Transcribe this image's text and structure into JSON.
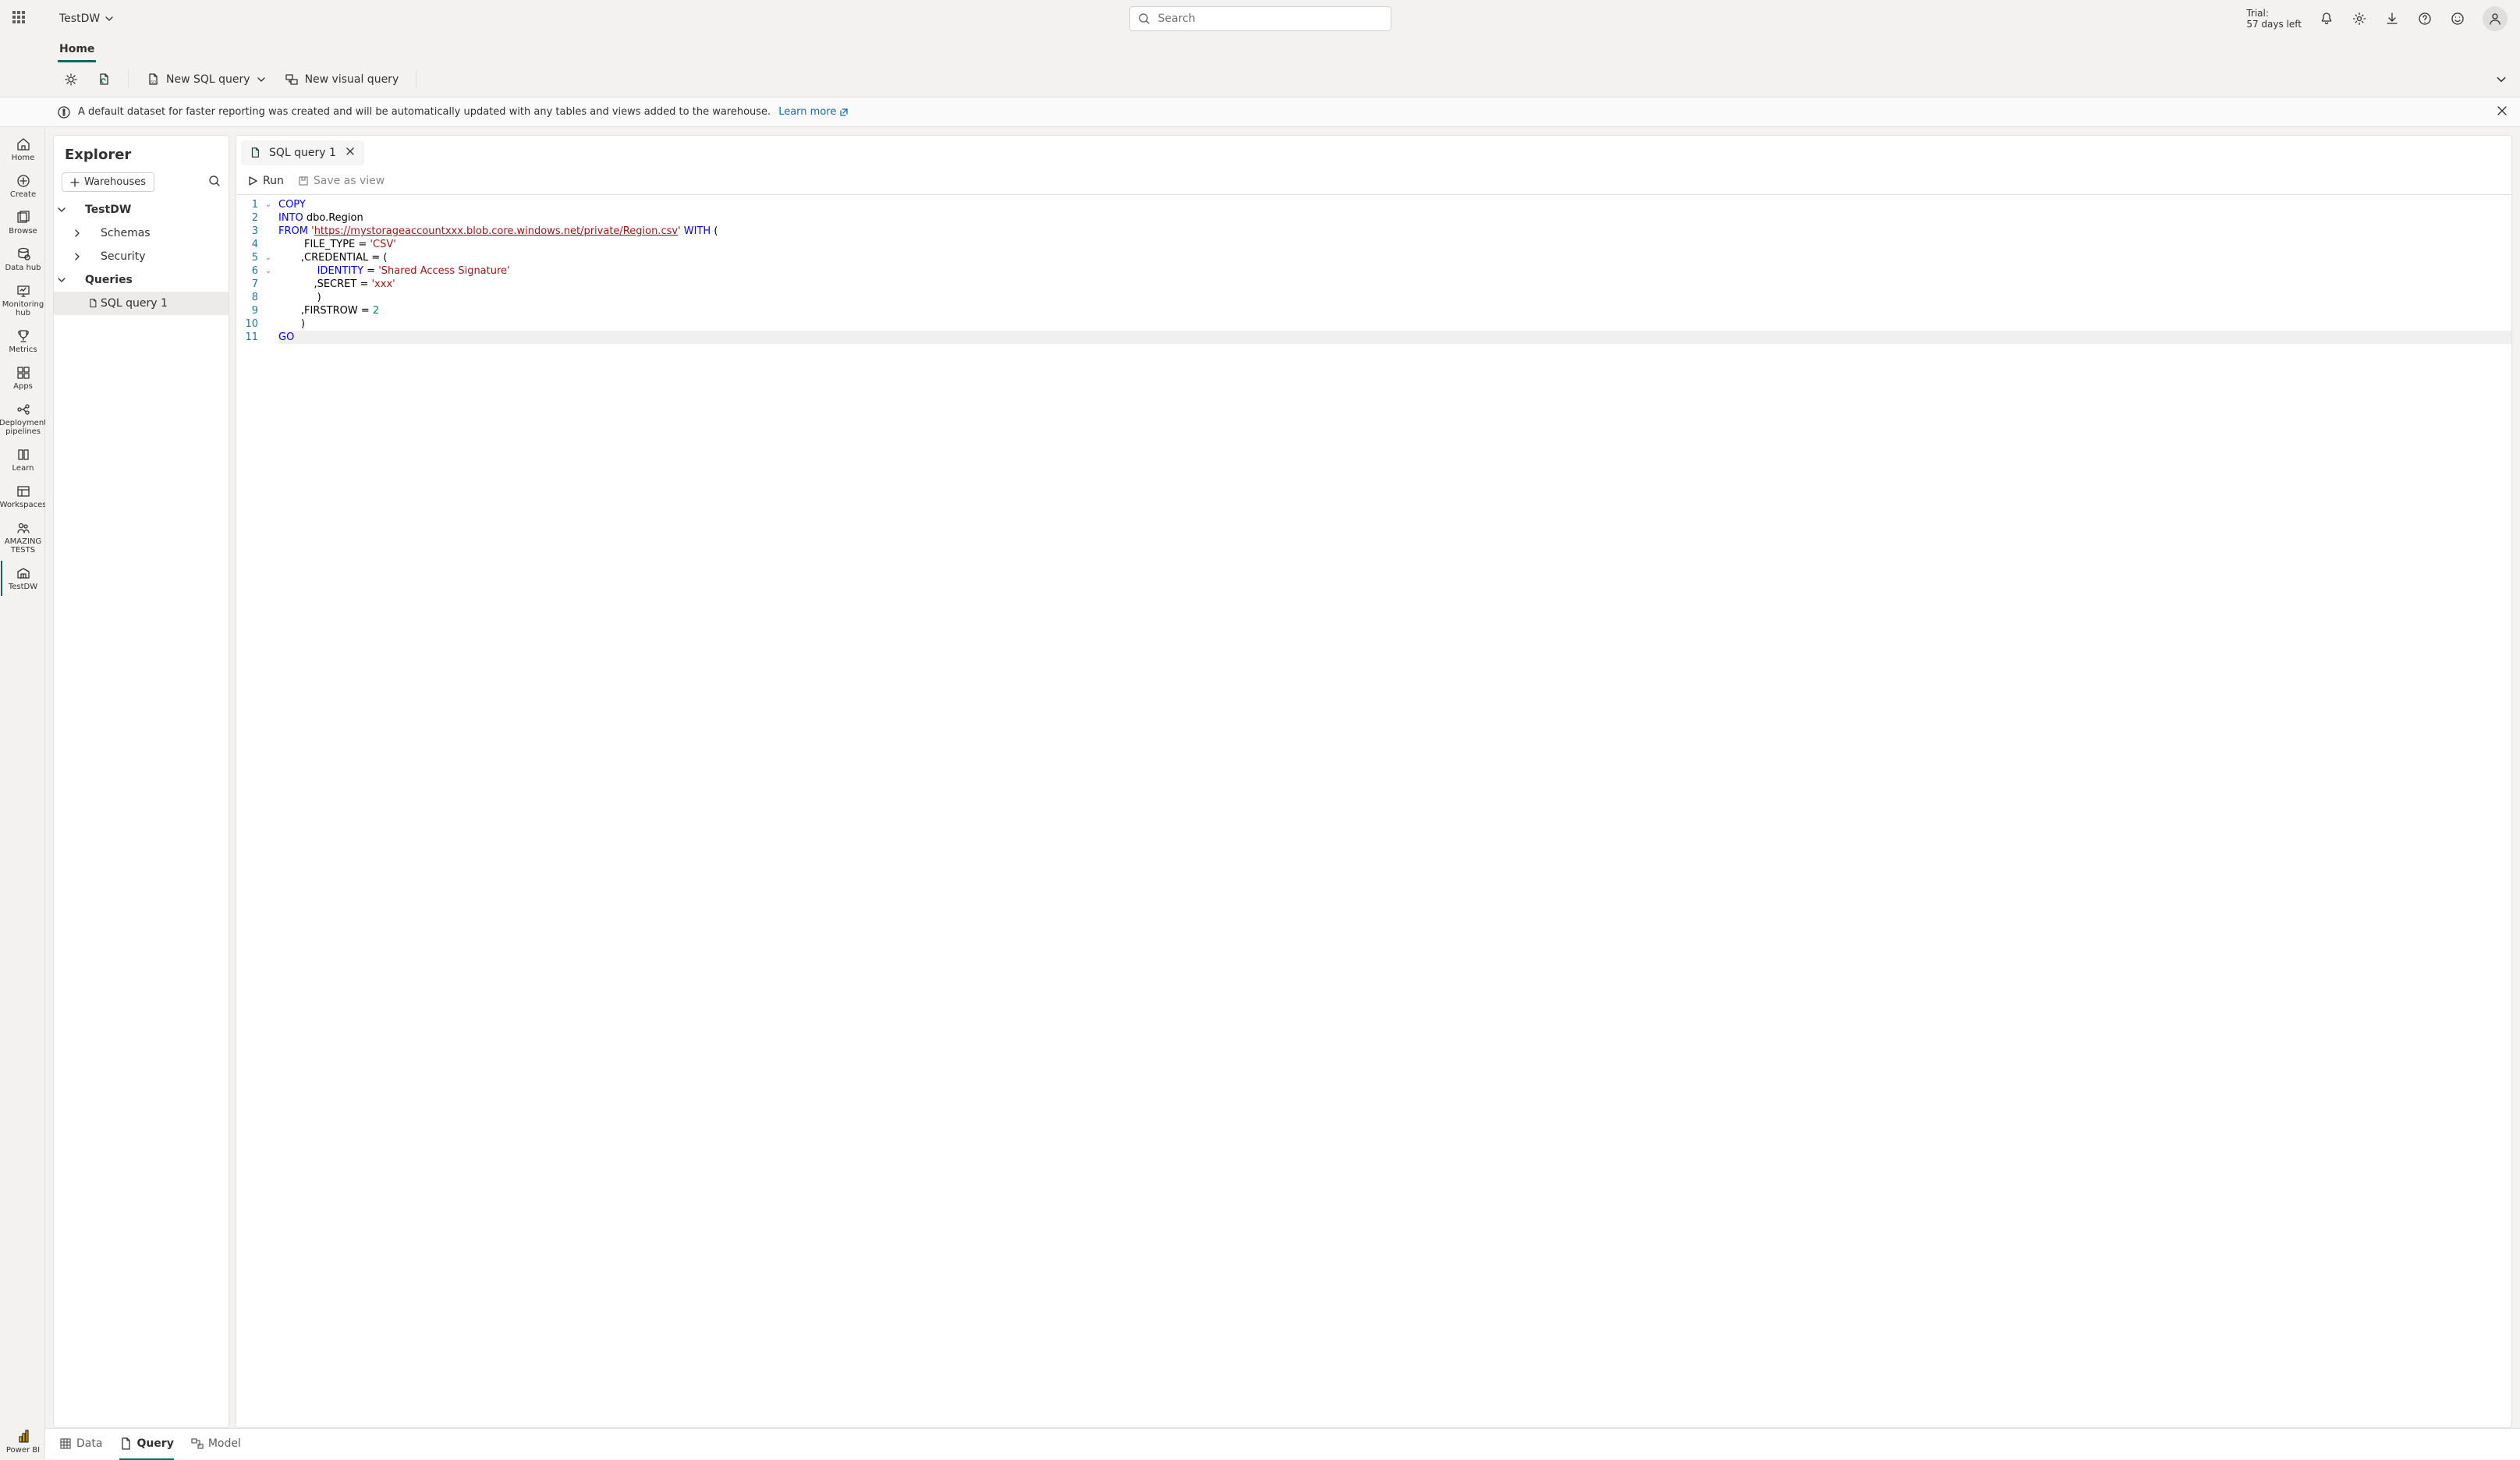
{
  "topbar": {
    "workspace_name": "TestDW",
    "search_placeholder": "Search",
    "trial_line1": "Trial:",
    "trial_line2": "57 days left"
  },
  "ribbon": {
    "tab_home": "Home",
    "new_sql_query": "New SQL query",
    "new_visual_query": "New visual query"
  },
  "infobar": {
    "message": "A default dataset for faster reporting was created and will be automatically updated with any tables and views added to the warehouse.",
    "learn_more": "Learn more"
  },
  "leftnav": {
    "home": "Home",
    "create": "Create",
    "browse": "Browse",
    "datahub": "Data hub",
    "monitoring": "Monitoring hub",
    "metrics": "Metrics",
    "apps": "Apps",
    "pipelines": "Deployment pipelines",
    "learn": "Learn",
    "workspaces": "Workspaces",
    "amazing": "AMAZING TESTS",
    "testdw": "TestDW",
    "powerbi": "Power BI"
  },
  "explorer": {
    "title": "Explorer",
    "warehouses_btn": "Warehouses",
    "root": "TestDW",
    "schemas": "Schemas",
    "security": "Security",
    "queries": "Queries",
    "sql_query_1": "SQL query 1"
  },
  "editor": {
    "tab_label": "SQL query 1",
    "run": "Run",
    "save_as_view": "Save as view",
    "code": {
      "l1_copy": "COPY",
      "l2_into": "INTO",
      "l2_rest": " dbo.Region",
      "l3_from": "FROM",
      "l3_q1": " '",
      "l3_url": "https://mystorageaccountxxx.blob.core.windows.net/private/Region.csv",
      "l3_q2": "'",
      "l3_with": " WITH",
      "l3_paren": " (",
      "l4_pre": "        FILE_TYPE = ",
      "l4_str": "'CSV'",
      "l5_pre": "       ,CREDENTIAL = (",
      "l6_pre": "            IDENTITY = ",
      "l6_ident": "IDENTITY",
      "l6_eq": " = ",
      "l6_str": "'Shared Access Signature'",
      "l6_indent": "            ",
      "l7_pre": "           ,SECRET = ",
      "l7_str": "'xxx'",
      "l8": "            )",
      "l9_pre": "       ,FIRSTROW = ",
      "l9_num": "2",
      "l10": "       )",
      "l11": "GO"
    },
    "line_numbers": [
      "1",
      "2",
      "3",
      "4",
      "5",
      "6",
      "7",
      "8",
      "9",
      "10",
      "11"
    ]
  },
  "bottombar": {
    "data": "Data",
    "query": "Query",
    "model": "Model"
  }
}
